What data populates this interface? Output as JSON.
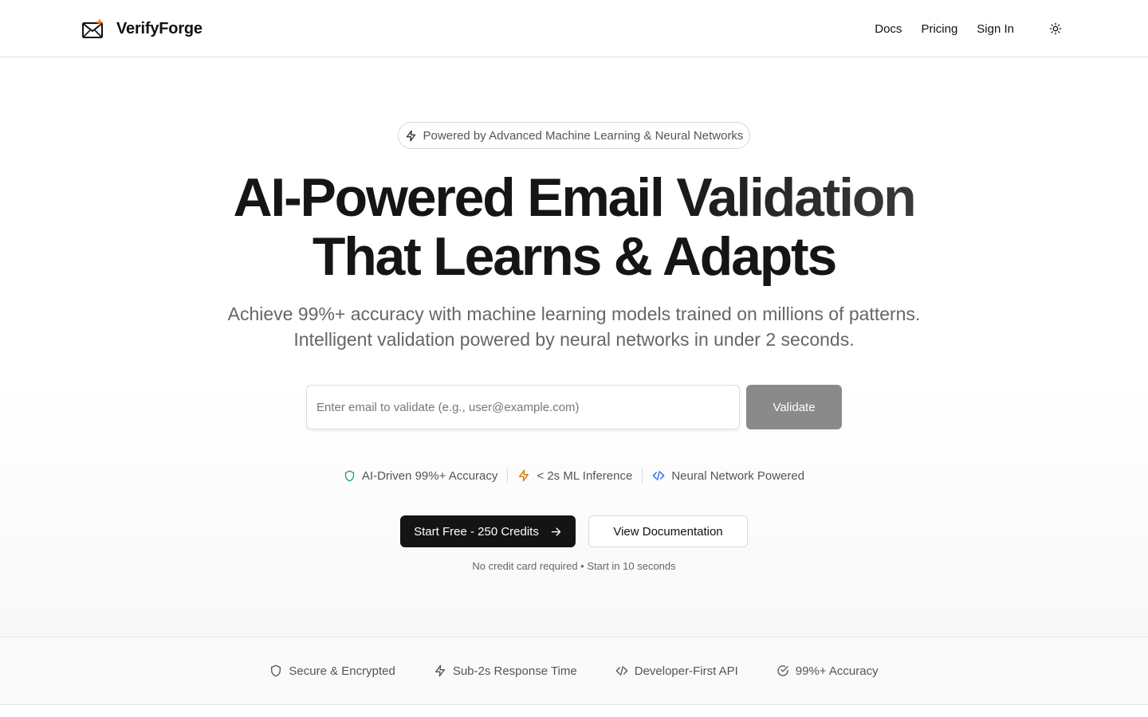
{
  "header": {
    "brand": "VerifyForge",
    "nav": [
      "Docs",
      "Pricing",
      "Sign In"
    ],
    "theme_icon": "sun-icon"
  },
  "hero": {
    "badge": "Powered by Advanced Machine Learning & Neural Networks",
    "headline_line1": "AI-Powered Email Validation",
    "headline_line2": "That Learns & Adapts",
    "sub_line1": "Achieve 99%+ accuracy with machine learning models trained on millions of patterns.",
    "sub_line2": "Intelligent validation powered by neural networks in under 2 seconds.",
    "email_placeholder": "Enter email to validate (e.g., user@example.com)",
    "validate_label": "Validate",
    "features": [
      {
        "label": "AI-Driven 99%+ Accuracy",
        "icon": "shield-icon",
        "color": "#16a34a"
      },
      {
        "label": "< 2s ML Inference",
        "icon": "zap-icon",
        "color": "#d97706"
      },
      {
        "label": "Neural Network Powered",
        "icon": "code-icon",
        "color": "#2563eb"
      }
    ],
    "primary_cta": "Start Free - 250 Credits",
    "secondary_cta": "View Documentation",
    "note": "No credit card required • Start in 10 seconds"
  },
  "trust": [
    {
      "label": "Secure & Encrypted",
      "icon": "shield-icon"
    },
    {
      "label": "Sub-2s Response Time",
      "icon": "zap-icon"
    },
    {
      "label": "Developer-First API",
      "icon": "code-icon"
    },
    {
      "label": "99%+ Accuracy",
      "icon": "check-circle-icon"
    }
  ],
  "colors": {
    "primary": "#141414",
    "accent": "#f97316",
    "validate_button": "#8a8a8a"
  }
}
